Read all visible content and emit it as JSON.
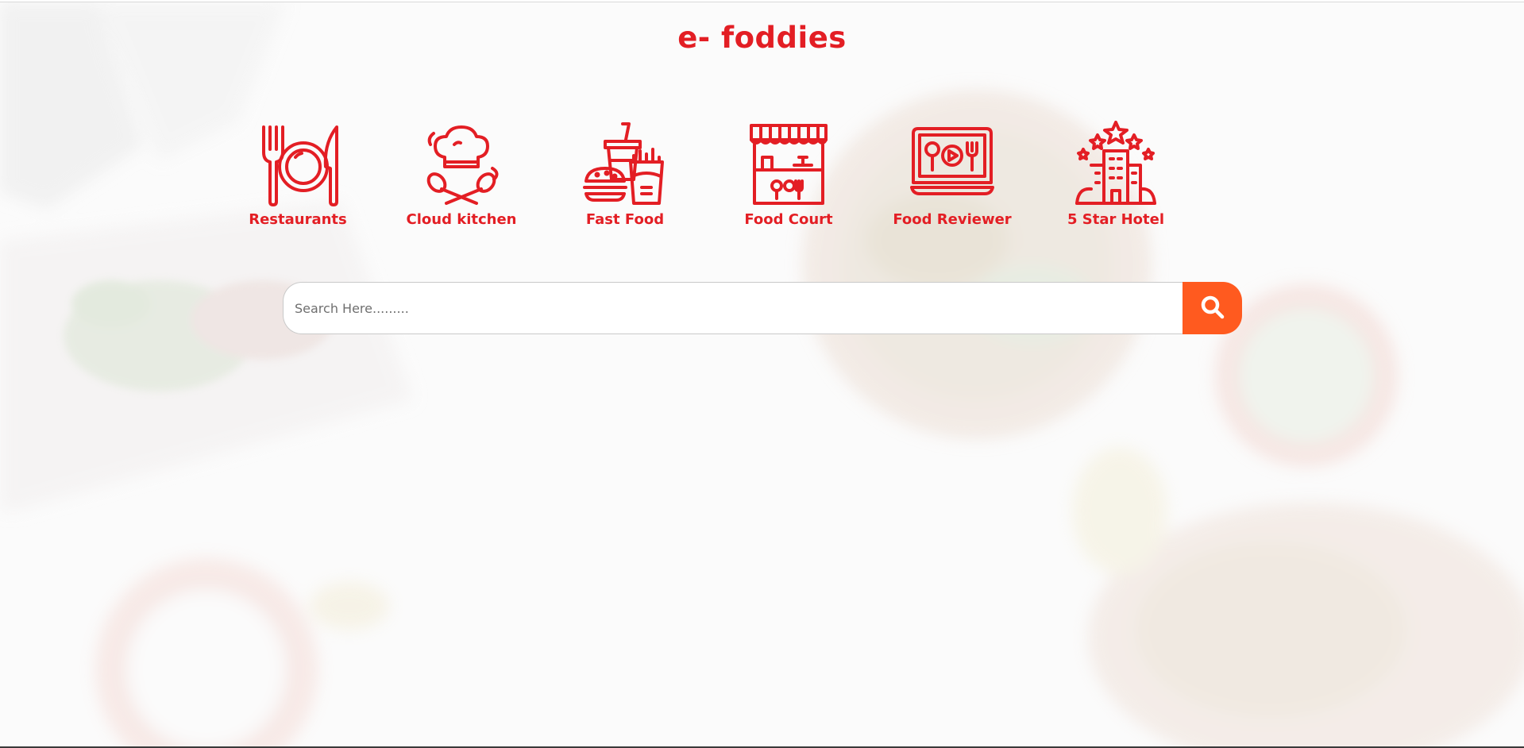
{
  "brand": {
    "title": "e- foddies"
  },
  "categories": [
    {
      "label": "Restaurants",
      "icon": "plate-cutlery-icon"
    },
    {
      "label": "Cloud kitchen",
      "icon": "chef-hat-spoons-icon"
    },
    {
      "label": "Fast Food",
      "icon": "burger-fries-drink-icon"
    },
    {
      "label": "Food Court",
      "icon": "food-stall-icon"
    },
    {
      "label": "Food Reviewer",
      "icon": "laptop-video-icon"
    },
    {
      "label": "5 Star Hotel",
      "icon": "hotel-stars-icon"
    }
  ],
  "search": {
    "placeholder": "Search Here.........",
    "value": "",
    "button_icon": "search-icon"
  },
  "colors": {
    "brand_red": "#e31e24",
    "search_button": "#ff5a1f",
    "background": "#fafafa"
  }
}
